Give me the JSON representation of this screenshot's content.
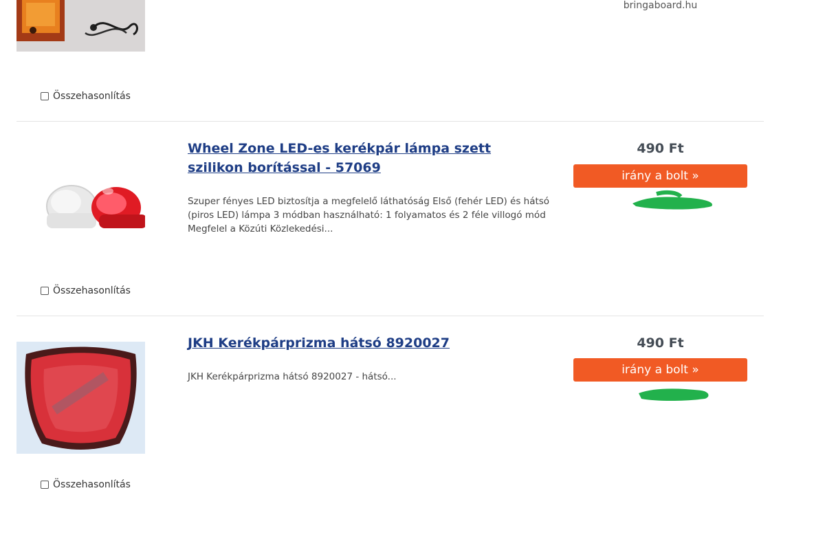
{
  "items": [
    {
      "shop": "bringaboard.hu",
      "compare_label": "Összehasonlítás"
    },
    {
      "title": "Wheel Zone LED-es kerékpár lámpa szett szilikon borítással - 57069",
      "description": "Szuper fényes LED biztosítja a megfelelő láthatóság Első (fehér LED) és hátsó (piros LED) lámpa 3 módban használható: 1 folyamatos és 2 féle villogó mód Megfelel a Közúti Közlekedési...",
      "price": "490 Ft",
      "button_label": "irány a bolt »",
      "compare_label": "Összehasonlítás"
    },
    {
      "title": "JKH Kerékpárprizma hátsó 8920027",
      "description": "JKH Kerékpárprizma hátsó 8920027 - hátsó...",
      "price": "490 Ft",
      "button_label": "irány a bolt »",
      "compare_label": "Összehasonlítás"
    }
  ],
  "colors": {
    "title_link": "#1e3d85",
    "button_bg": "#f15a24",
    "button_text": "#ffffff",
    "price_text": "#444c55",
    "redaction_marker": "#22b14c"
  }
}
